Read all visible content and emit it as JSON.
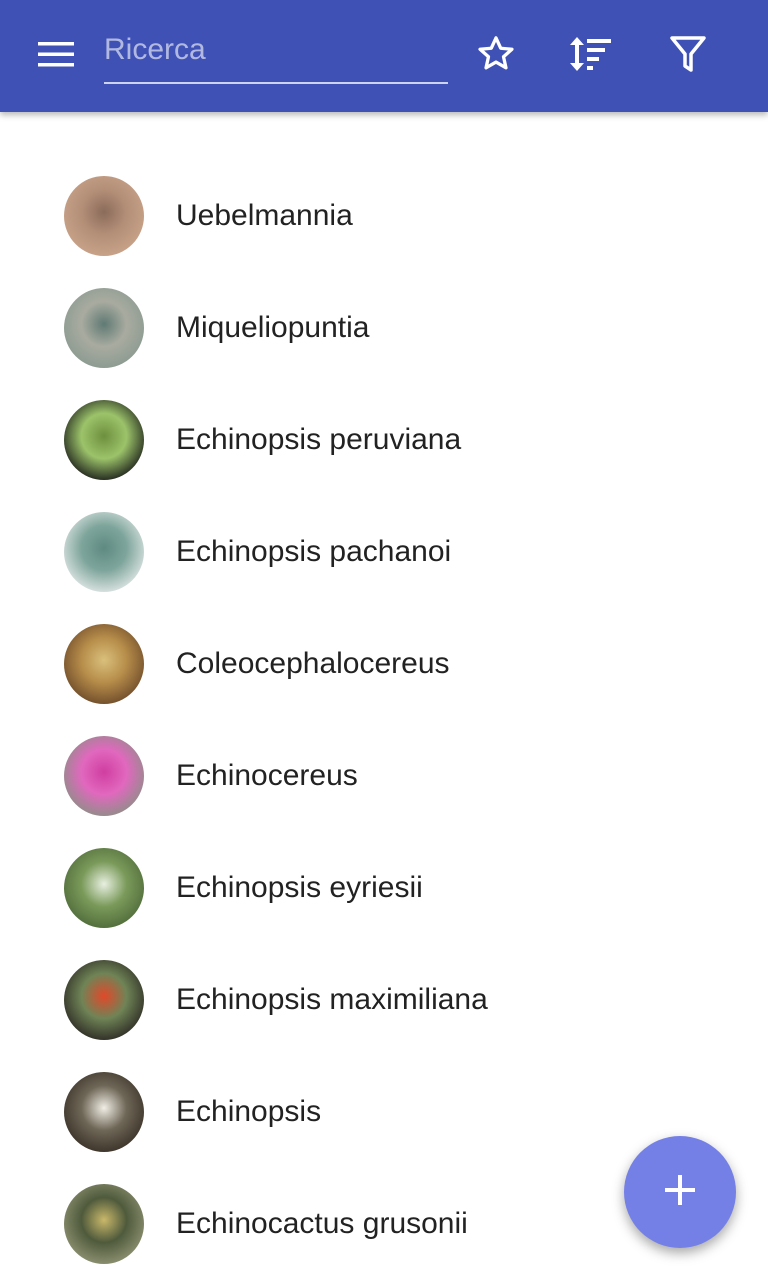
{
  "toolbar": {
    "menu_icon": "hamburger-menu-icon",
    "search_placeholder": "Ricerca",
    "search_value": "",
    "favorite_icon": "star-outline-icon",
    "sort_icon": "sort-icon",
    "filter_icon": "filter-icon",
    "background_color": "#3f51b5"
  },
  "plants": [
    {
      "name": "Uebelmannia",
      "thumb_colors": [
        "#c9a48a",
        "#8a6b5a",
        "#b48f78"
      ]
    },
    {
      "name": "Miqueliopuntia",
      "thumb_colors": [
        "#8a9a90",
        "#5f7a74",
        "#a9aba0"
      ]
    },
    {
      "name": "Echinopsis peruviana",
      "thumb_colors": [
        "#1c1f1a",
        "#6d8f3e",
        "#9cc36a"
      ]
    },
    {
      "name": "Echinopsis pachanoi",
      "thumb_colors": [
        "#dfe6e5",
        "#5e8a82",
        "#7ea59b"
      ]
    },
    {
      "name": "Coleocephalocereus",
      "thumb_colors": [
        "#6e4b2a",
        "#d9c07c",
        "#b78d4a"
      ]
    },
    {
      "name": "Echinocereus",
      "thumb_colors": [
        "#8e8f86",
        "#d03ea0",
        "#e168be"
      ]
    },
    {
      "name": "Echinopsis eyriesii",
      "thumb_colors": [
        "#4f6b3a",
        "#e8efe0",
        "#7a9a5a"
      ]
    },
    {
      "name": "Echinopsis maximiliana",
      "thumb_colors": [
        "#2d2a24",
        "#e0492a",
        "#6f8456"
      ]
    },
    {
      "name": "Echinopsis",
      "thumb_colors": [
        "#3a3128",
        "#f1eee6",
        "#6e6656"
      ]
    },
    {
      "name": "Echinocactus grusonii",
      "thumb_colors": [
        "#8f9373",
        "#c9b86a",
        "#4f5a3c"
      ]
    }
  ],
  "fab": {
    "icon": "plus-icon",
    "color": "#7480e6"
  }
}
